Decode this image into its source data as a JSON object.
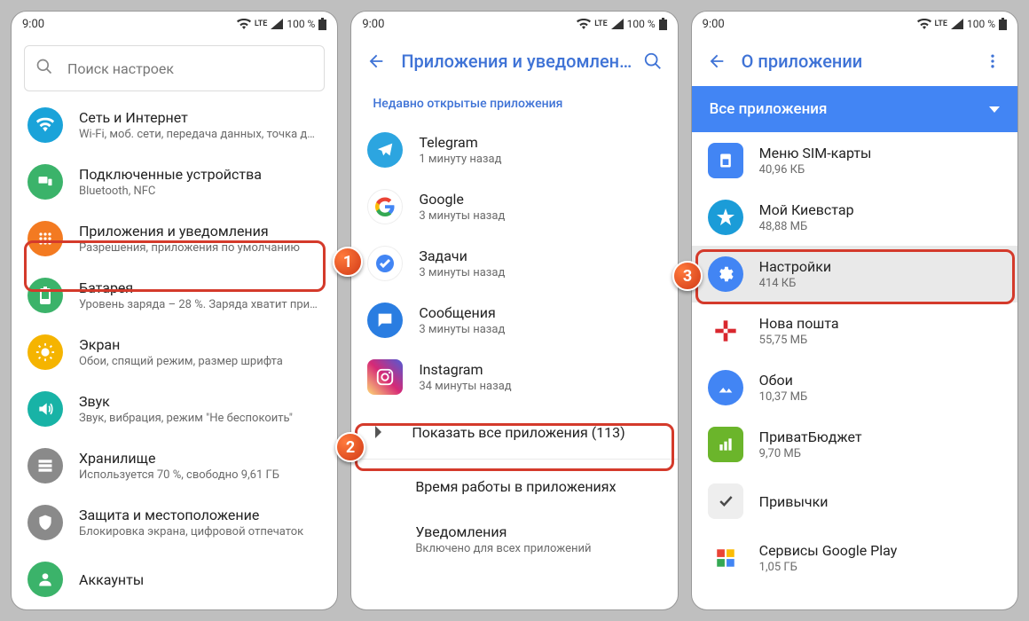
{
  "status": {
    "time": "9:00",
    "net": "LTE",
    "battery": "100 %"
  },
  "screen1": {
    "search_placeholder": "Поиск настроек",
    "items": [
      {
        "title": "Сеть и Интернет",
        "sub": "Wi-Fi, моб. сети, передача данных, точка дост…"
      },
      {
        "title": "Подключенные устройства",
        "sub": "Bluetooth, NFC"
      },
      {
        "title": "Приложения и уведомления",
        "sub": "Разрешения, приложения по умолчанию"
      },
      {
        "title": "Батарея",
        "sub": "Уровень заряда – 28 %. Заряда хватит приме…"
      },
      {
        "title": "Экран",
        "sub": "Обои, спящий режим, размер шрифта"
      },
      {
        "title": "Звук",
        "sub": "Звук, вибрация, режим \"Не беспокоить\""
      },
      {
        "title": "Хранилище",
        "sub": "Используется 70 %, свободно 9,61 ГБ"
      },
      {
        "title": "Защита и местоположение",
        "sub": "Блокировка экрана, цифровой отпечаток"
      },
      {
        "title": "Аккаунты",
        "sub": ""
      }
    ]
  },
  "screen2": {
    "title": "Приложения и уведомления",
    "section": "Недавно открытые приложения",
    "recent": [
      {
        "title": "Telegram",
        "sub": "1 минуту назад"
      },
      {
        "title": "Google",
        "sub": "3 минуты назад"
      },
      {
        "title": "Задачи",
        "sub": "3 минуты назад"
      },
      {
        "title": "Сообщения",
        "sub": "3 минуты назад"
      },
      {
        "title": "Instagram",
        "sub": "34 минуты назад"
      }
    ],
    "show_all": "Показать все приложения (113)",
    "rows": [
      {
        "title": "Время работы в приложениях",
        "sub": ""
      },
      {
        "title": "Уведомления",
        "sub": "Включено для всех приложений"
      }
    ]
  },
  "screen3": {
    "title": "О приложении",
    "bar": "Все приложения",
    "apps": [
      {
        "title": "Меню SIM-карты",
        "sub": "40,96 КБ"
      },
      {
        "title": "Мой Киевстар",
        "sub": "48,88 МБ"
      },
      {
        "title": "Настройки",
        "sub": "414 КБ"
      },
      {
        "title": "Нова пошта",
        "sub": "55,75 МБ"
      },
      {
        "title": "Обои",
        "sub": "10,37 МБ"
      },
      {
        "title": "ПриватБюджет",
        "sub": "9,70 МБ"
      },
      {
        "title": "Привычки",
        "sub": ""
      },
      {
        "title": "Сервисы Google Play",
        "sub": "1,05 ГБ"
      }
    ]
  },
  "callouts": {
    "c1": "1",
    "c2": "2",
    "c3": "3"
  }
}
